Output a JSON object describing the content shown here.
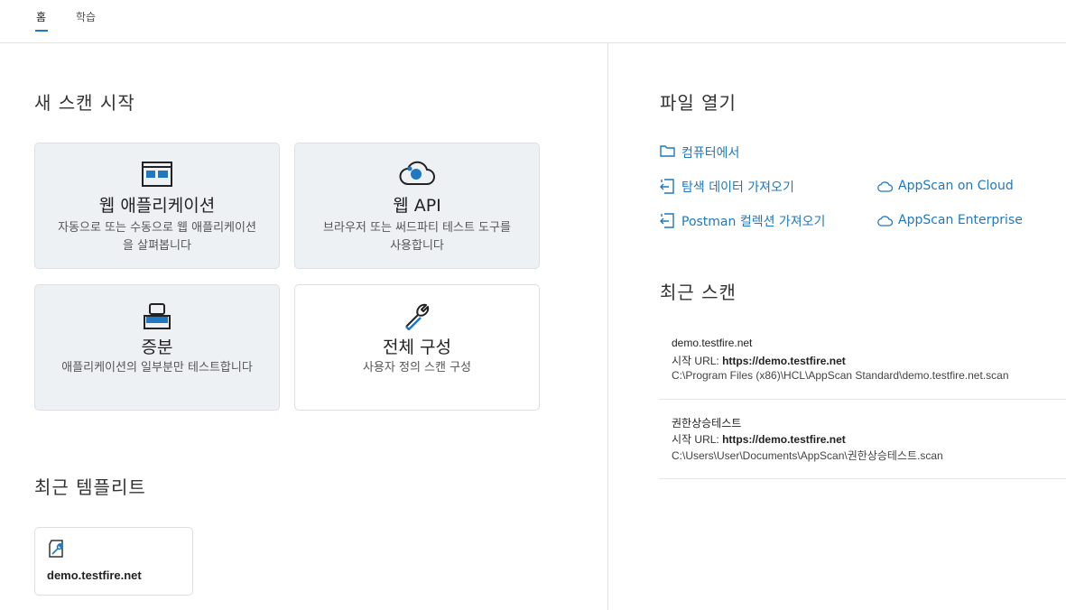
{
  "tabs": [
    {
      "label": "홈",
      "active": true
    },
    {
      "label": "학습",
      "active": false
    }
  ],
  "new_scan": {
    "heading": "새 스캔 시작",
    "cards": [
      {
        "title": "웹 애플리케이션",
        "desc_line1": "자동으로 또는 수동으로 웹 애플리케이션",
        "desc_line2": "을 살펴봅니다",
        "icon": "web-app-icon"
      },
      {
        "title": "웹 API",
        "desc_line1": "브라우저 또는 써드파티 테스트 도구를",
        "desc_line2": "사용합니다",
        "icon": "cloud-api-icon"
      },
      {
        "title": "증분",
        "desc_line1": "애플리케이션의 일부분만 테스트합니다",
        "icon": "incremental-icon"
      },
      {
        "title": "전체 구성",
        "desc_line1": "사용자 정의 스캔 구성",
        "icon": "wrench-icon"
      }
    ]
  },
  "recent_templates": {
    "heading": "최근 템플리트",
    "items": [
      {
        "label": "demo.testfire.net",
        "icon": "template-wrench-icon"
      }
    ]
  },
  "open_file": {
    "heading": "파일 열기",
    "links": {
      "from_computer": "컴퓨터에서",
      "import_explore": "탐색 데이터 가져오기",
      "import_postman": "Postman 컬렉션 가져오기",
      "appscan_cloud": "AppScan on Cloud",
      "appscan_enterprise": "AppScan Enterprise"
    }
  },
  "recent_scans": {
    "heading": "최근 스캔",
    "url_prefix": "시작 URL: ",
    "items": [
      {
        "name": "demo.testfire.net",
        "url": "https://demo.testfire.net",
        "path": "C:\\Program Files (x86)\\HCL\\AppScan Standard\\demo.testfire.net.scan"
      },
      {
        "name": "권한상승테스트",
        "url": "https://demo.testfire.net",
        "path": "C:\\Users\\User\\Documents\\AppScan\\권한상승테스트.scan"
      }
    ]
  },
  "colors": {
    "accent": "#1f78c1",
    "card_bg": "#eef1f4",
    "border": "#dcdfe3"
  }
}
